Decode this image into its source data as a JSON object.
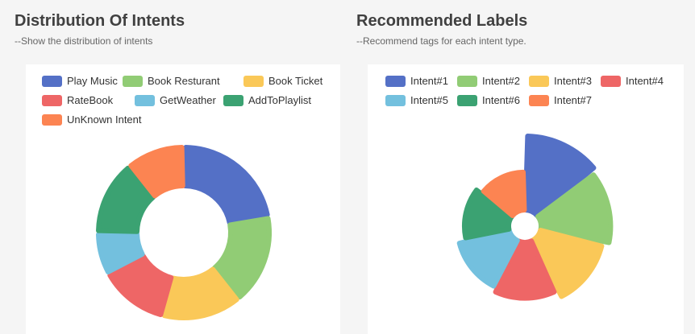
{
  "left": {
    "title": "Distribution Of Intents",
    "subtitle": "--Show the distribution of intents"
  },
  "right": {
    "title": "Recommended Labels",
    "subtitle": "--Recommend tags for each intent type."
  },
  "chart_data": [
    {
      "type": "pie",
      "variant": "doughnut",
      "legend_position": "top",
      "categories": [
        "Play Music",
        "Book Resturant",
        "Book Ticket",
        "RateBook",
        "GetWeather",
        "AddToPlaylist",
        "UnKnown Intent"
      ],
      "values": [
        22,
        17,
        15,
        13,
        8,
        14,
        11
      ],
      "colors": [
        "#5470c6",
        "#91cc75",
        "#fac858",
        "#ee6666",
        "#73c0de",
        "#3ba272",
        "#fc8452"
      ]
    },
    {
      "type": "pie",
      "variant": "rose",
      "legend_position": "top",
      "categories": [
        "Intent#1",
        "Intent#2",
        "Intent#3",
        "Intent#4",
        "Intent#5",
        "Intent#6",
        "Intent#7"
      ],
      "values": [
        100,
        95,
        88,
        80,
        75,
        67,
        60
      ],
      "colors": [
        "#5470c6",
        "#91cc75",
        "#fac858",
        "#ee6666",
        "#73c0de",
        "#3ba272",
        "#fc8452"
      ]
    }
  ]
}
